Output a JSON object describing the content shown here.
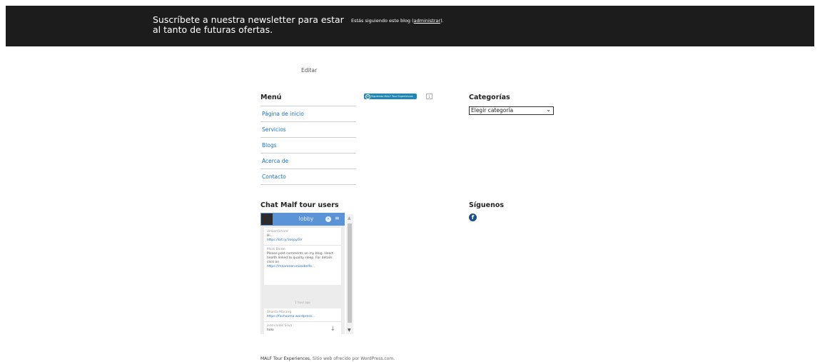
{
  "topbar": {
    "newsletter_text": "Suscríbete a nuestra newsletter para estar al tanto de futuras ofertas.",
    "following_prefix": "Estás siguiendo este blog (",
    "following_link": "administrar",
    "following_suffix": ")."
  },
  "edit_label": "Editar",
  "menu": {
    "title": "Menú",
    "items": [
      "Página de inicio",
      "Servicios",
      "Blogs",
      "Acerca de",
      "Contacto"
    ]
  },
  "follow": {
    "label": "Siguiendo MALF Tour Experiences",
    "count": "1"
  },
  "categories": {
    "title": "Categorías",
    "select_value": "Elegir categoría"
  },
  "chat": {
    "title": "Chat Malf tour users",
    "room": "lobby",
    "messages": [
      {
        "user": "desiorrichard",
        "text": "Hi...",
        "link": "https://bit.ly/3oopyGV"
      },
      {
        "user": "Mark Baron",
        "text": "Please post comments on my blog. Heart health linked to quality sleep. For details click on",
        "link": "https://maaronoruniaalbelfo..."
      },
      {
        "user": "Shanta Marang",
        "text": "",
        "link": "https://fashuoma.wordpress..."
      },
      {
        "user": "jeancarlos Silva",
        "text": "hola",
        "link": ""
      }
    ],
    "more_label": "1 hour ago"
  },
  "social": {
    "title": "Síguenos",
    "facebook_icon": "facebook-icon"
  },
  "footer": {
    "site_name": "MALF Tour Experiences",
    "powered_text": ", Sitio web ofrecido por WordPress.com."
  }
}
